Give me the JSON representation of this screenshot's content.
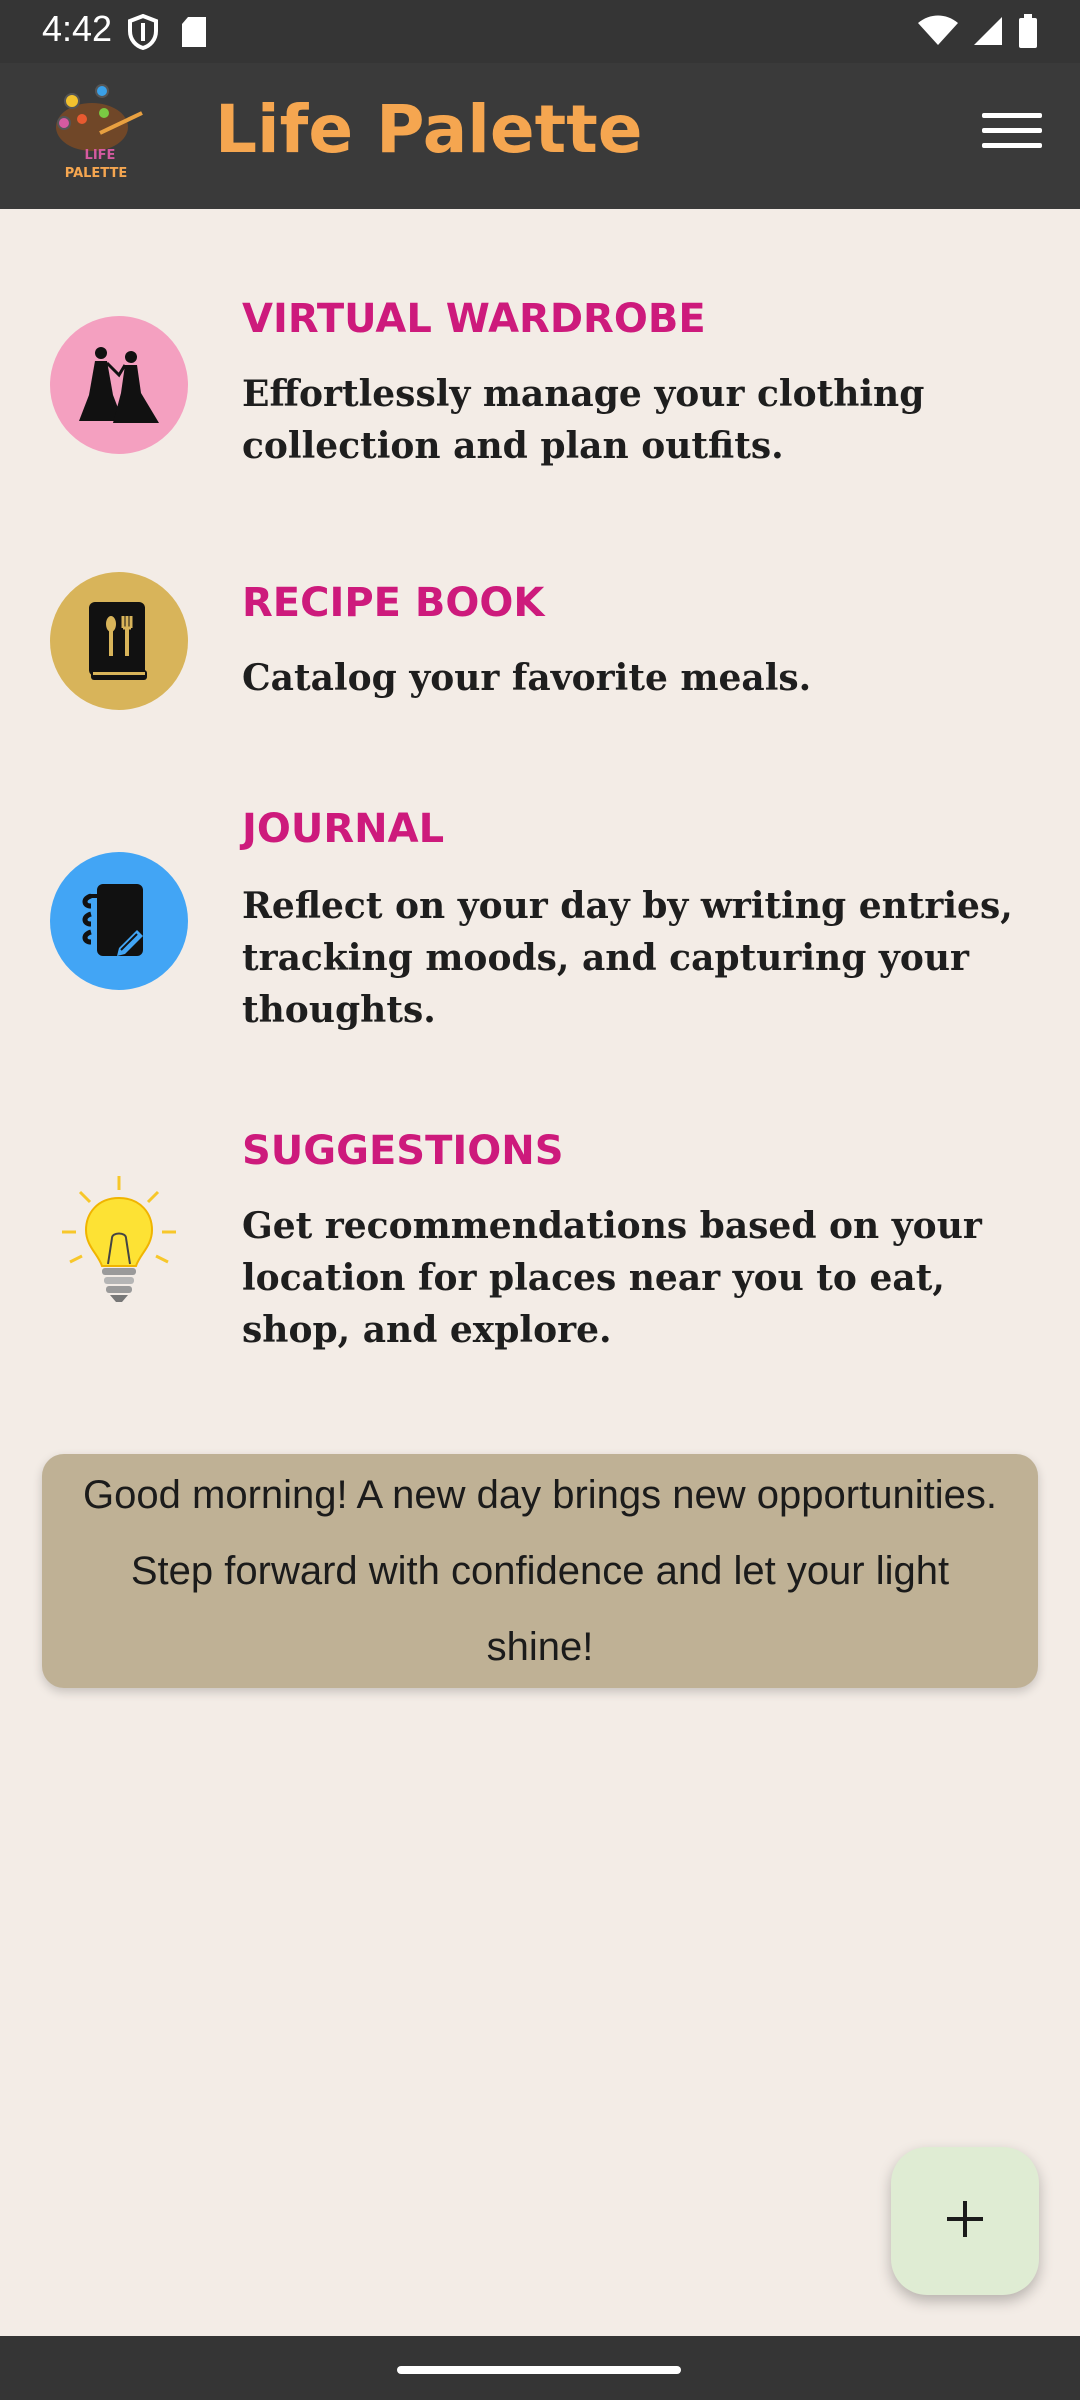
{
  "status_bar": {
    "time": "4:42",
    "left_icons": [
      "shield-icon",
      "sd-card-icon"
    ],
    "right_icons": [
      "wifi-icon",
      "signal-icon",
      "battery-icon"
    ]
  },
  "app_bar": {
    "title": "Life Palette",
    "logo_text": "LIFE PALETTE",
    "title_color": "#f5a650",
    "menu_icon": "hamburger-menu-icon"
  },
  "features": [
    {
      "title": "VIRTUAL WARDROBE",
      "description": "Effortlessly manage your clothing collection and plan outfits.",
      "icon": "wardrobe-icon",
      "icon_bg": "#f4a0c0"
    },
    {
      "title": "RECIPE BOOK",
      "description": "Catalog your favorite meals.",
      "icon": "recipe-book-icon",
      "icon_bg": "#d8b45a"
    },
    {
      "title": "JOURNAL",
      "description": "Reflect on your day by writing entries, tracking moods, and capturing your thoughts.",
      "icon": "journal-icon",
      "icon_bg": "#42a5f5"
    },
    {
      "title": "SUGGESTIONS",
      "description": "Get recommendations based on your location for places near you to eat, shop, and explore.",
      "icon": "lightbulb-icon",
      "icon_bg": "transparent"
    }
  ],
  "greeting": {
    "text": "Good morning! A new day brings new opportunities. Step forward with confidence and let your light shine!"
  },
  "fab": {
    "icon": "plus-icon"
  },
  "colors": {
    "background": "#f3ece6",
    "accent_title": "#cd1a7c",
    "card_bg": "#bfb195",
    "fab_bg": "#dfecd3"
  }
}
